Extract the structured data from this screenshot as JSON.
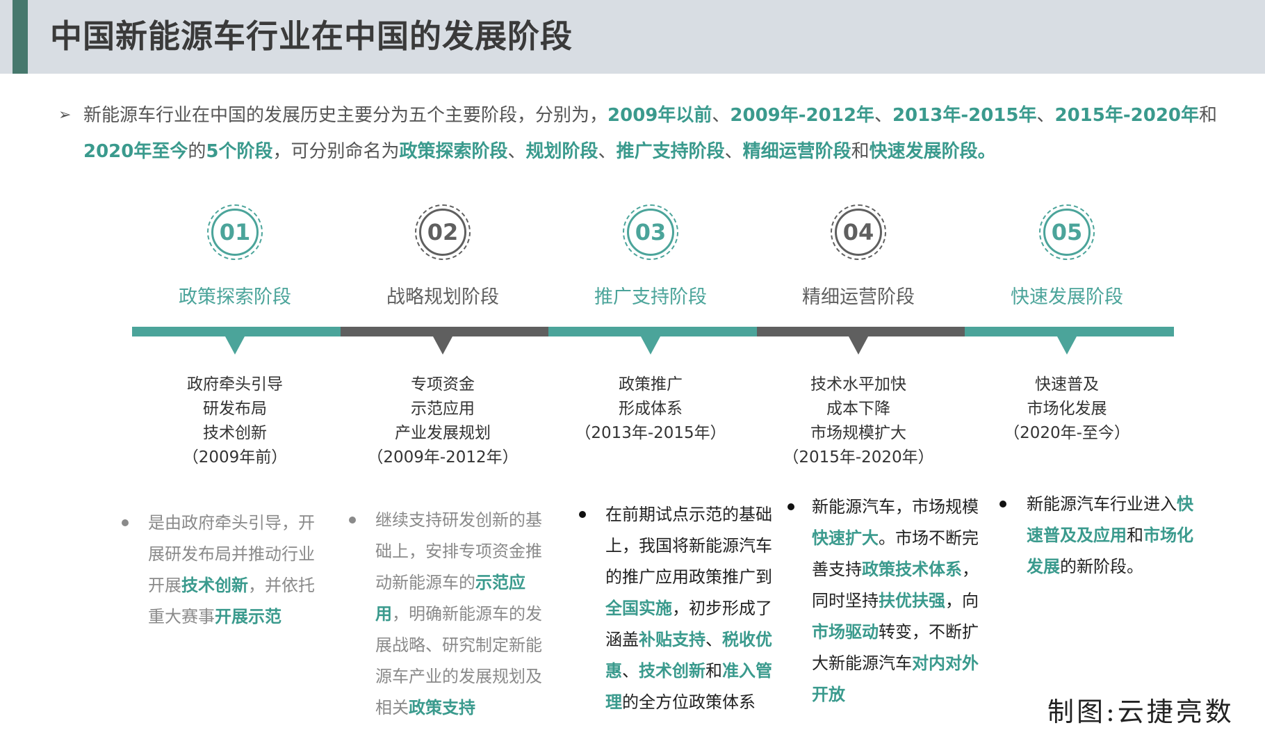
{
  "header": {
    "title": "中国新能源车行业在中国的发展阶段"
  },
  "intro": {
    "arrow": "➢",
    "segments": [
      {
        "text": "新能源车行业在中国的发展历史主要分为五个主要阶段，分别为，",
        "hl": false
      },
      {
        "text": "2009年以前",
        "hl": true
      },
      {
        "text": "、",
        "hl": false
      },
      {
        "text": "2009年-2012年",
        "hl": true
      },
      {
        "text": "、",
        "hl": false
      },
      {
        "text": "2013年-2015年",
        "hl": true
      },
      {
        "text": "、",
        "hl": false
      },
      {
        "text": "2015年-2020年",
        "hl": true
      },
      {
        "text": "和",
        "hl": false
      },
      {
        "text": "2020年至今",
        "hl": true
      },
      {
        "text": "的",
        "hl": false
      },
      {
        "text": "5个阶段",
        "hl": true
      },
      {
        "text": "，可分别命名为",
        "hl": false
      },
      {
        "text": "政策探索阶段",
        "hl": true
      },
      {
        "text": "、",
        "hl": false
      },
      {
        "text": "规划阶段",
        "hl": true
      },
      {
        "text": "、",
        "hl": false
      },
      {
        "text": "推广支持阶段",
        "hl": true
      },
      {
        "text": "、",
        "hl": false
      },
      {
        "text": "精细运营阶段",
        "hl": true
      },
      {
        "text": "和",
        "hl": false
      },
      {
        "text": "快速发展阶段。",
        "hl": true
      }
    ]
  },
  "colors": {
    "teal": "#4ba49a",
    "gray": "#5f5f5f",
    "accent": "#3a9a8d"
  },
  "stages": [
    {
      "number": "01",
      "name": "政策探索阶段",
      "color": "#4ba49a",
      "keywords": [
        "政府牵头引导",
        "研发布局",
        "技术创新",
        "（2009年前）"
      ],
      "desc_color": "#8a8a8a",
      "description": [
        {
          "text": "是由政府牵头引导，开展研发布局并推动行业开展",
          "hl": false
        },
        {
          "text": "技术创新",
          "hl": true
        },
        {
          "text": "，并依托重大赛事",
          "hl": false
        },
        {
          "text": "开展示范",
          "hl": true
        }
      ]
    },
    {
      "number": "02",
      "name": "战略规划阶段",
      "color": "#5f5f5f",
      "keywords": [
        "专项资金",
        "示范应用",
        "产业发展规划",
        "（2009年-2012年）"
      ],
      "desc_color": "#8a8a8a",
      "description": [
        {
          "text": "继续支持研发创新的基础上，安排专项资金推动新能源车的",
          "hl": false
        },
        {
          "text": "示范应用",
          "hl": true
        },
        {
          "text": "，明确新能源车的发展战略、研究制定新能源车产业的发展规划及相关",
          "hl": false
        },
        {
          "text": "政策支持",
          "hl": true
        }
      ]
    },
    {
      "number": "03",
      "name": "推广支持阶段",
      "color": "#4ba49a",
      "keywords": [
        "政策推广",
        "形成体系",
        "（2013年-2015年）"
      ],
      "desc_color": "#222222",
      "description": [
        {
          "text": "在前期试点示范的基础上，我国将新能源汽车的推广应用政策推广到",
          "hl": false
        },
        {
          "text": "全国实施",
          "hl": true
        },
        {
          "text": "，初步形成了涵盖",
          "hl": false
        },
        {
          "text": "补贴支持",
          "hl": true
        },
        {
          "text": "、",
          "hl": false
        },
        {
          "text": "税收优惠",
          "hl": true
        },
        {
          "text": "、",
          "hl": false
        },
        {
          "text": "技术创新",
          "hl": true
        },
        {
          "text": "和",
          "hl": false
        },
        {
          "text": "准入管理",
          "hl": true
        },
        {
          "text": "的全方位政策体系",
          "hl": false
        }
      ]
    },
    {
      "number": "04",
      "name": "精细运营阶段",
      "color": "#5f5f5f",
      "keywords": [
        "技术水平加快",
        "成本下降",
        "市场规模扩大",
        "（2015年-2020年）"
      ],
      "desc_color": "#222222",
      "description": [
        {
          "text": "新能源汽车，市场规模",
          "hl": false
        },
        {
          "text": "快速扩大",
          "hl": true
        },
        {
          "text": "。市场不断完善支持",
          "hl": false
        },
        {
          "text": "政策技术体系",
          "hl": true
        },
        {
          "text": "，同时坚持",
          "hl": false
        },
        {
          "text": "扶优扶强",
          "hl": true
        },
        {
          "text": "，向",
          "hl": false
        },
        {
          "text": "市场驱动",
          "hl": true
        },
        {
          "text": "转变，不断扩大新能源汽车",
          "hl": false
        },
        {
          "text": "对内对外开放",
          "hl": true
        }
      ]
    },
    {
      "number": "05",
      "name": "快速发展阶段",
      "color": "#4ba49a",
      "keywords": [
        "快速普及",
        "市场化发展",
        "（2020年-至今）"
      ],
      "desc_color": "#222222",
      "description": [
        {
          "text": "新能源汽车行业进入",
          "hl": false
        },
        {
          "text": "快速普及及应用",
          "hl": true
        },
        {
          "text": "和",
          "hl": false
        },
        {
          "text": "市场化发展",
          "hl": true
        },
        {
          "text": "的新阶段。",
          "hl": false
        }
      ]
    }
  ],
  "credit": "制图:云捷亮数"
}
